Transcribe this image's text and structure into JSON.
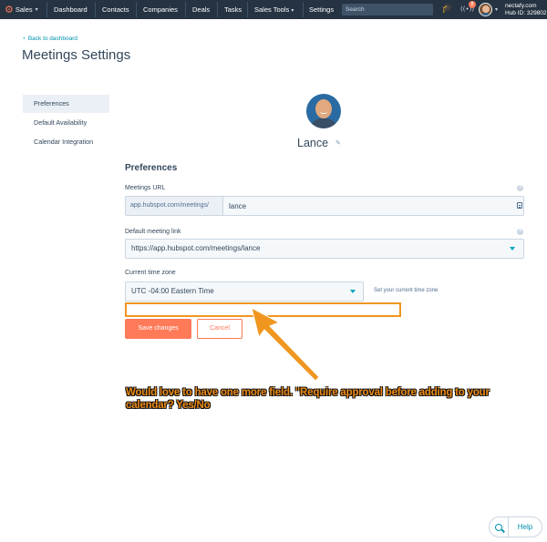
{
  "nav": {
    "app_label": "Sales",
    "items": [
      "Dashboard",
      "Contacts",
      "Companies",
      "Deals",
      "Tasks",
      "Sales Tools",
      "Settings"
    ],
    "search_placeholder": "Search",
    "notification_count": "8",
    "account_name": "nectafy.com",
    "hub_id": "Hub ID: 329802"
  },
  "header": {
    "back_link": "Back to dashboard",
    "title": "Meetings Settings"
  },
  "sidebar": {
    "items": [
      {
        "label": "Preferences",
        "active": true
      },
      {
        "label": "Default Availability",
        "active": false
      },
      {
        "label": "Calendar Integration",
        "active": false
      }
    ]
  },
  "profile": {
    "name": "Lance"
  },
  "form": {
    "section_title": "Preferences",
    "meetings_url": {
      "label": "Meetings URL",
      "prefix": "app.hubspot.com/meetings/",
      "value": "lance"
    },
    "default_link": {
      "label": "Default meeting link",
      "value": "https://app.hubspot.com/meetings/lance"
    },
    "timezone": {
      "label": "Current time zone",
      "value": "UTC -04:00 Eastern Time",
      "hint": "Set your current time zone"
    },
    "save_label": "Save changes",
    "cancel_label": "Cancel"
  },
  "annotation": {
    "text": "Would love to have one more field. \"Require approval before adding to your calendar? Yes/No",
    "color": "#ee8a14"
  },
  "help_widget": {
    "label": "Help"
  },
  "colors": {
    "nav_bg": "#253342",
    "accent_orange": "#ff7a59",
    "link_blue": "#0091ae",
    "annotation_orange": "#f0961f"
  }
}
